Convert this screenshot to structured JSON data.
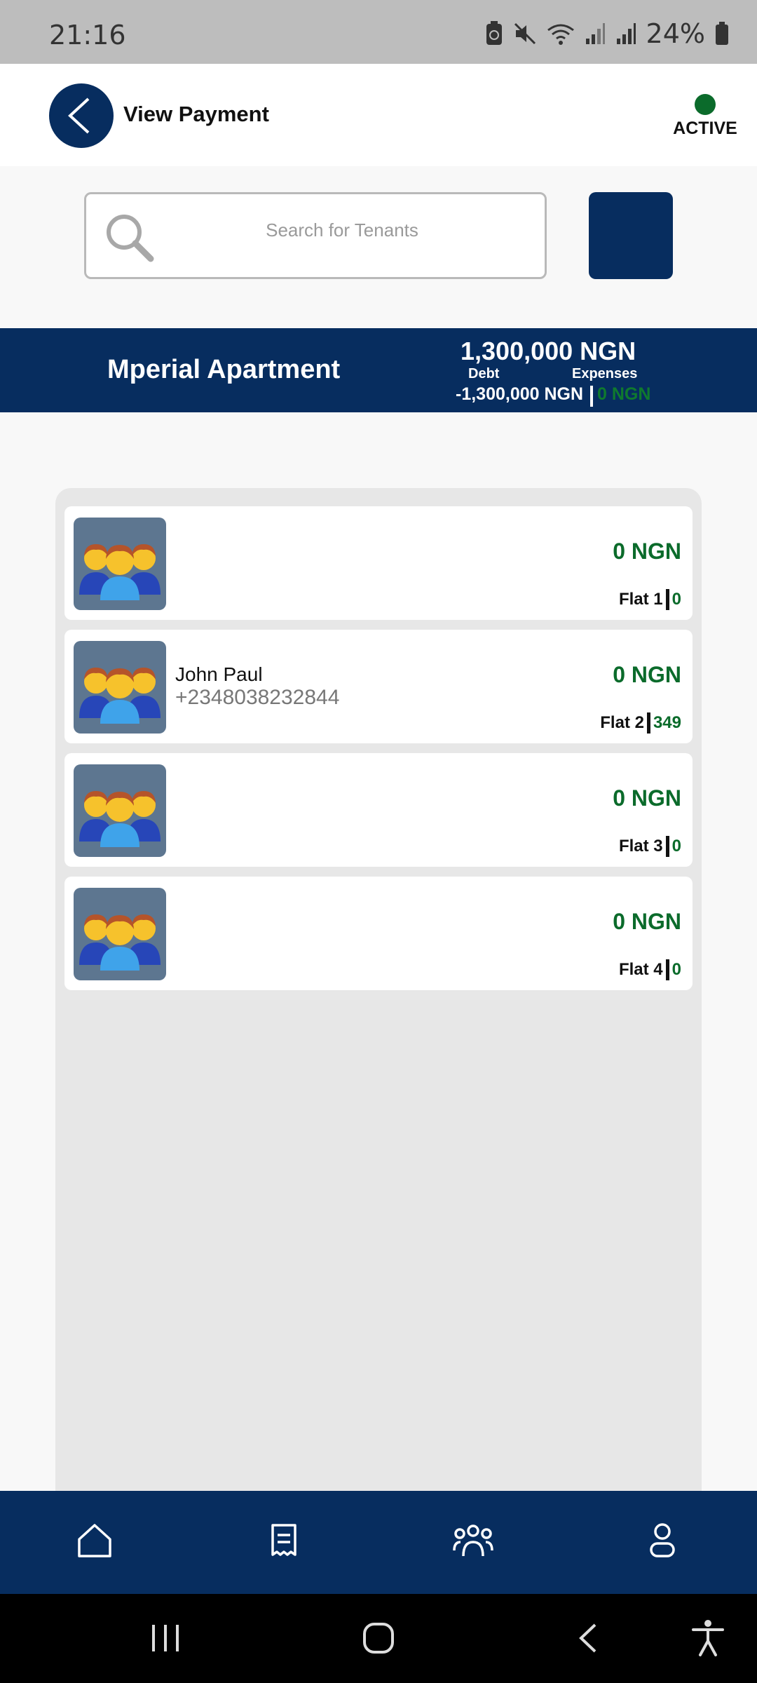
{
  "status_bar": {
    "time": "21:16",
    "battery_percent": "24%",
    "icons": [
      "battery-saver-icon",
      "mute-icon",
      "wifi-icon",
      "signal-icon",
      "signal-icon",
      "battery-icon"
    ]
  },
  "header": {
    "title": "View Payment",
    "status_label": "ACTIVE",
    "status_color": "#0b6b2b"
  },
  "search": {
    "placeholder": "Search for Tenants"
  },
  "property": {
    "name": "Mperial Apartment",
    "total": "1,300,000 NGN",
    "debt_label": "Debt",
    "expenses_label": "Expenses",
    "debt_value": "-1,300,000 NGN",
    "expenses_value": "0 NGN"
  },
  "tenants": [
    {
      "name": "",
      "phone": "",
      "amount": "0 NGN",
      "flat": "Flat 1",
      "flat_value": "0"
    },
    {
      "name": "John Paul",
      "phone": "+2348038232844",
      "amount": "0 NGN",
      "flat": "Flat 2",
      "flat_value": "349"
    },
    {
      "name": "",
      "phone": "",
      "amount": "0 NGN",
      "flat": "Flat 3",
      "flat_value": "0"
    },
    {
      "name": "",
      "phone": "",
      "amount": "0 NGN",
      "flat": "Flat 4",
      "flat_value": "0"
    }
  ],
  "bottom_nav": [
    "home-icon",
    "receipt-icon",
    "tenants-icon",
    "profile-icon"
  ],
  "colors": {
    "brand": "#072d5f",
    "positive": "#0b6b2b"
  }
}
